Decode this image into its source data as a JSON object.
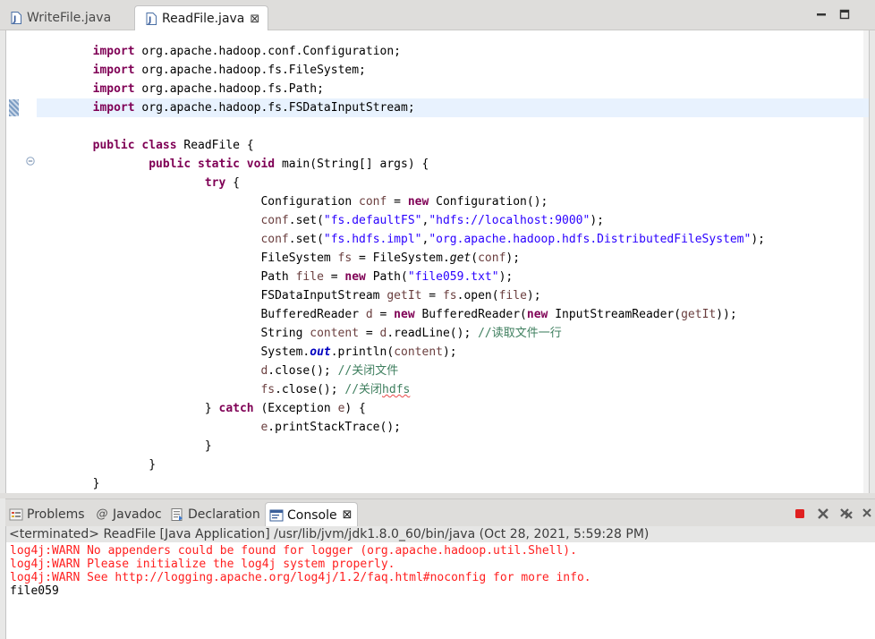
{
  "editor_tabs": [
    {
      "label": "WriteFile.java",
      "active": false
    },
    {
      "label": "ReadFile.java",
      "active": true,
      "close_glyph": "⊠"
    }
  ],
  "icons": {
    "java_file": "java-file-icon",
    "minimize": "minimize-icon",
    "maximize": "maximize-icon"
  },
  "code": {
    "line1": {
      "kw": "import",
      "text": " org.apache.hadoop.conf.Configuration;"
    },
    "line2": {
      "kw": "import",
      "text": " org.apache.hadoop.fs.FileSystem;"
    },
    "line3": {
      "kw": "import",
      "text": " org.apache.hadoop.fs.Path;"
    },
    "line4": {
      "kw": "import",
      "text": " org.apache.hadoop.fs.FSDataInputStream;"
    },
    "class_line": {
      "kw": "public class",
      "text": " ReadFile {"
    },
    "main_line": {
      "kw": "public static void",
      "text": " main(String[] args) {"
    },
    "try_kw": "try",
    "s1": {
      "t1": "Configuration ",
      "v": "conf",
      "t2": " = ",
      "kw": "new",
      "t3": " Configuration();"
    },
    "s2": {
      "v": "conf",
      "t1": ".set(",
      "str1": "\"fs.defaultFS\"",
      "t2": ",",
      "str2": "\"hdfs://localhost:9000\"",
      "t3": ");"
    },
    "s3": {
      "v": "conf",
      "t1": ".set(",
      "str1": "\"fs.hdfs.impl\"",
      "t2": ",",
      "str2": "\"org.apache.hadoop.hdfs.DistributedFileSystem\"",
      "t3": ");"
    },
    "s4": {
      "t1": "FileSystem ",
      "v": "fs",
      "t2": " = FileSystem.",
      "m": "get",
      "t3": "(",
      "v2": "conf",
      "t4": ");"
    },
    "s5": {
      "t1": "Path ",
      "v": "file",
      "t2": " = ",
      "kw": "new",
      "t3": " Path(",
      "str": "\"file059.txt\"",
      "t4": ");"
    },
    "s6": {
      "t1": "FSDataInputStream ",
      "v": "getIt",
      "t2": " = ",
      "v2": "fs",
      "t3": ".open(",
      "v3": "file",
      "t4": ");"
    },
    "s7": {
      "t1": "BufferedReader ",
      "v": "d",
      "t2": " = ",
      "kw": "new",
      "t3": " BufferedReader(",
      "kw2": "new",
      "t4": " InputStreamReader(",
      "v2": "getIt",
      "t5": "));"
    },
    "s8": {
      "t1": "String ",
      "v": "content",
      "t2": " = ",
      "v2": "d",
      "t3": ".readLine(); ",
      "cmt": "//读取文件一行"
    },
    "s9": {
      "t1": "System.",
      "f": "out",
      "t2": ".println(",
      "v": "content",
      "t3": ");"
    },
    "s10": {
      "v": "d",
      "t1": ".close(); ",
      "cmt": "//关闭文件"
    },
    "s11": {
      "v": "fs",
      "t1": ".close(); ",
      "cmt": "//关闭",
      "cmt2": "hdfs"
    },
    "catch_line": {
      "t1": "} ",
      "kw": "catch",
      "t2": " (Exception ",
      "v": "e",
      "t3": ") {"
    },
    "s12": {
      "v": "e",
      "t1": ".printStackTrace();"
    },
    "close1": "}",
    "close2": "}",
    "close3": "}"
  },
  "panel_tabs": [
    {
      "label": "Problems",
      "icon": "problems-icon"
    },
    {
      "label": "Javadoc",
      "icon": "javadoc-icon",
      "glyph": "@"
    },
    {
      "label": "Declaration",
      "icon": "declaration-icon"
    },
    {
      "label": "Console",
      "icon": "console-icon",
      "active": true,
      "close_glyph": "⊠"
    }
  ],
  "console": {
    "status": "<terminated> ReadFile [Java Application] /usr/lib/jvm/jdk1.8.0_60/bin/java (Oct 28, 2021, 5:59:28 PM)",
    "lines": [
      {
        "text": "log4j:WARN No appenders could be found for logger (org.apache.hadoop.util.Shell).",
        "type": "err"
      },
      {
        "text": "log4j:WARN Please initialize the log4j system properly.",
        "type": "err"
      },
      {
        "text": "log4j:WARN See http://logging.apache.org/log4j/1.2/faq.html#noconfig for more info.",
        "type": "err"
      },
      {
        "text": "file059",
        "type": "out"
      }
    ]
  },
  "colors": {
    "keyword": "#7f0055",
    "string": "#2a00ff",
    "variable": "#6a3e3e",
    "comment": "#3f7f5f",
    "stderr": "#ff2020",
    "terminate_red": "#e02020"
  }
}
